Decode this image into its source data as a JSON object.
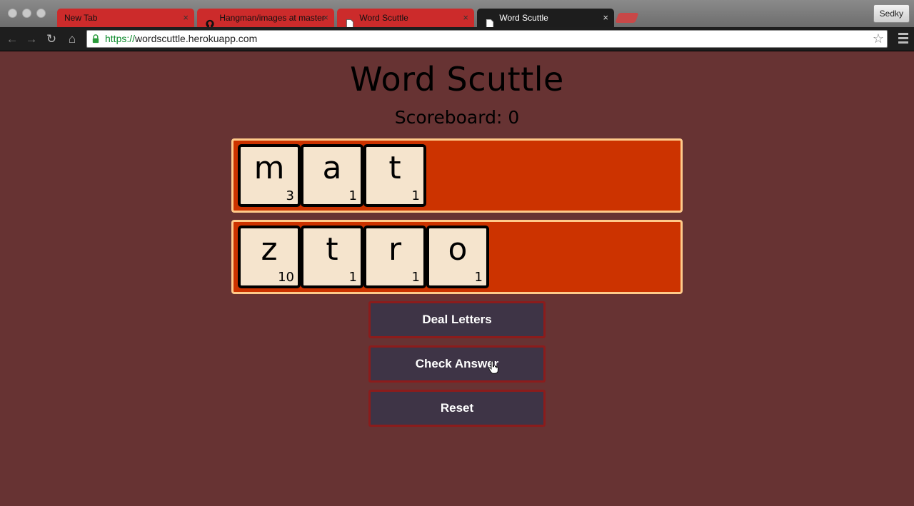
{
  "browser": {
    "tabs": [
      {
        "title": "New Tab",
        "active": false
      },
      {
        "title": "Hangman/images at master",
        "active": false
      },
      {
        "title": "Word Scuttle",
        "active": false
      },
      {
        "title": "Word Scuttle",
        "active": true
      }
    ],
    "tab_close_glyph": "×",
    "profile": "Sedky",
    "url_scheme": "https://",
    "url_host": "wordscuttle.herokuapp.com",
    "icons": {
      "back": "back-arrow-icon",
      "forward": "forward-arrow-icon",
      "reload": "reload-icon",
      "home": "home-icon",
      "lock": "lock-icon",
      "star": "bookmark-star-icon",
      "menu": "hamburger-menu-icon"
    }
  },
  "game": {
    "title": "Word Scuttle",
    "scoreboard": "Scoreboard: 0",
    "answer_row": [
      {
        "letter": "m",
        "points": "3"
      },
      {
        "letter": "a",
        "points": "1"
      },
      {
        "letter": "t",
        "points": "1"
      }
    ],
    "hand_row": [
      {
        "letter": "z",
        "points": "10"
      },
      {
        "letter": "t",
        "points": "1"
      },
      {
        "letter": "r",
        "points": "1"
      },
      {
        "letter": "o",
        "points": "1"
      }
    ],
    "buttons": {
      "deal": "Deal Letters",
      "check": "Check Answer",
      "reset": "Reset"
    }
  },
  "colors": {
    "page_background": "#673333",
    "rack": "#cc3300",
    "rack_border": "#ffca8a",
    "tile": "#f5e4cd",
    "button": "#3e3446",
    "button_border": "#8b1c1c"
  }
}
